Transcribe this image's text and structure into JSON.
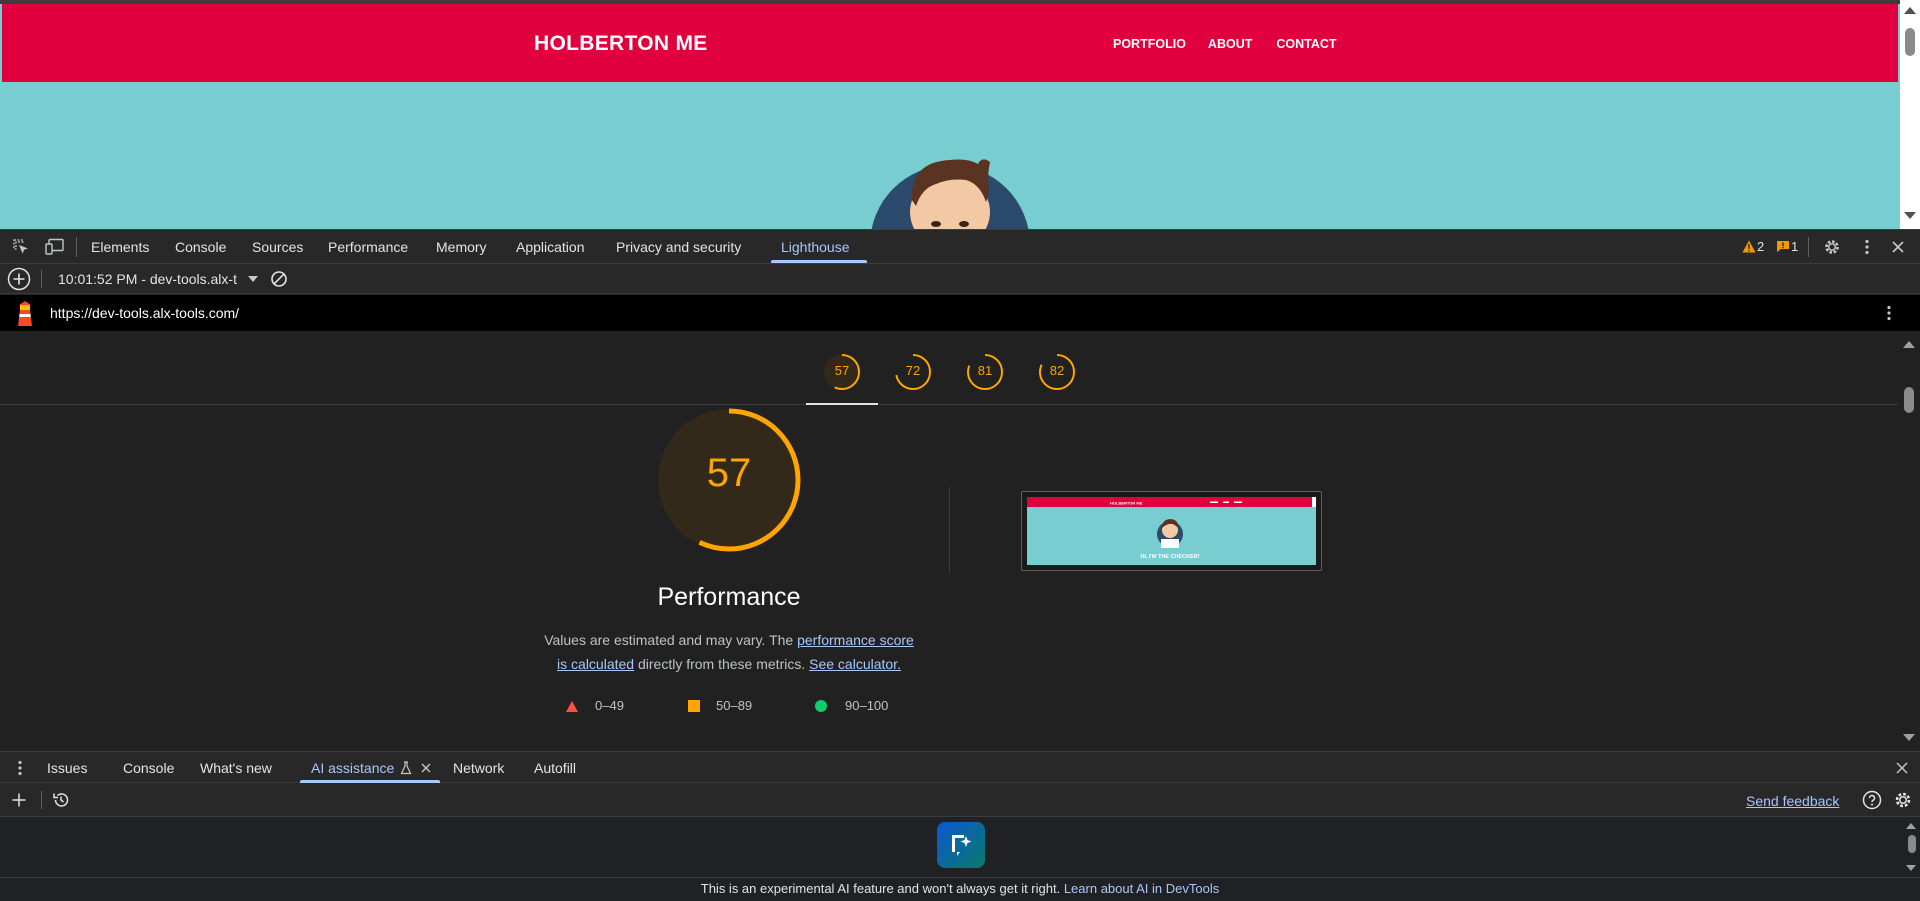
{
  "site": {
    "logo": "HOLBERTON ME",
    "nav": [
      "PORTFOLIO",
      "ABOUT",
      "CONTACT"
    ],
    "header_color": "#e1003d",
    "hero_color": "#78cdd1"
  },
  "devtools": {
    "tabs": [
      "Elements",
      "Console",
      "Sources",
      "Performance",
      "Memory",
      "Application",
      "Privacy and security",
      "Lighthouse"
    ],
    "active_tab": "Lighthouse",
    "warning_count": "2",
    "issue_count": "1"
  },
  "lighthouse": {
    "report_select": "10:01:52 PM - dev-tools.alx-t",
    "url": "https://dev-tools.alx-tools.com/",
    "scores": [
      57,
      72,
      81,
      82
    ],
    "main_score": 57,
    "category_title": "Performance",
    "desc_prefix": "Values are estimated and may vary. The ",
    "desc_link1a": "performance score",
    "desc_link1b": "is calculated",
    "desc_middle": " directly from these metrics. ",
    "desc_link2": "See calculator.",
    "legend": [
      {
        "shape": "triangle",
        "label": "0–49",
        "color": "#ff4e42"
      },
      {
        "shape": "square",
        "label": "50–89",
        "color": "#ffa400"
      },
      {
        "shape": "circle",
        "label": "90–100",
        "color": "#0cce6b"
      }
    ],
    "thumbnail": {
      "logo": "HOLBERTON ME",
      "hero": "HI, I'M THE CHECKER!"
    }
  },
  "drawer": {
    "tabs": [
      "Issues",
      "Console",
      "What's new",
      "AI assistance",
      "Network",
      "Autofill"
    ],
    "active_tab": "AI assistance",
    "send_feedback": "Send feedback",
    "disclaimer": "This is an experimental AI feature and won't always get it right. ",
    "disclaimer_link": "Learn about AI in DevTools"
  }
}
